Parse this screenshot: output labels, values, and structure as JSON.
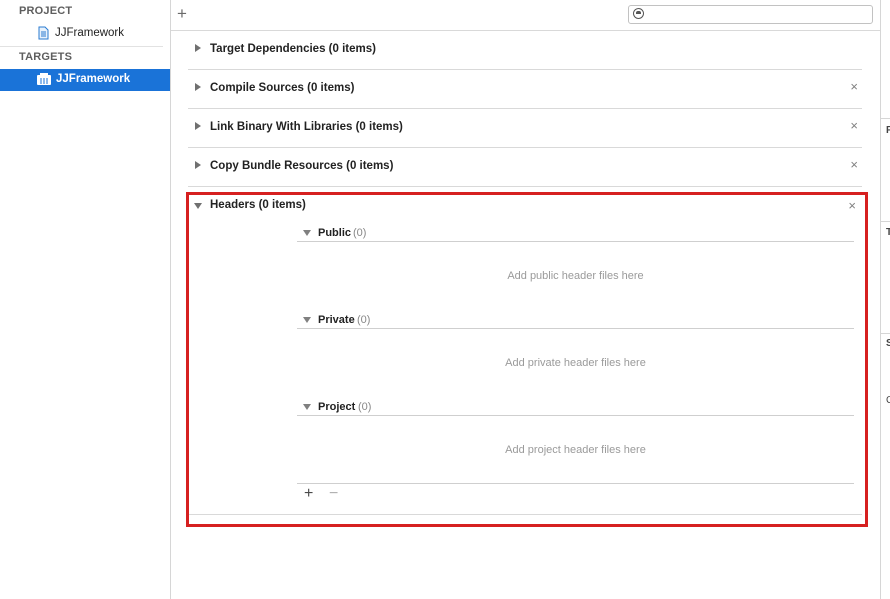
{
  "sidebar": {
    "project_header": "PROJECT",
    "project_item": "JJFramework",
    "targets_header": "TARGETS",
    "target_item": "JJFramework"
  },
  "toolbar": {
    "add_label": "+",
    "search_value": "",
    "search_placeholder": ""
  },
  "phases": [
    {
      "title": "Target Dependencies (0 items)",
      "closable": false
    },
    {
      "title": "Compile Sources (0 items)",
      "closable": true
    },
    {
      "title": "Link Binary With Libraries (0 items)",
      "closable": true
    },
    {
      "title": "Copy Bundle Resources (0 items)",
      "closable": true
    }
  ],
  "close_symbol": "×",
  "headers": {
    "title": "Headers (0 items)",
    "sections": [
      {
        "label": "Public",
        "count": "(0)",
        "hint": "Add public header files here"
      },
      {
        "label": "Private",
        "count": "(0)",
        "hint": "Add private header files here"
      },
      {
        "label": "Project",
        "count": "(0)",
        "hint": "Add project header files here"
      }
    ],
    "add_button": "+",
    "remove_button": "−"
  },
  "right_panel_letters": [
    "F",
    "T",
    "S",
    "C"
  ],
  "colors": {
    "selection": "#1a73d8",
    "highlight_box": "#d62020"
  }
}
